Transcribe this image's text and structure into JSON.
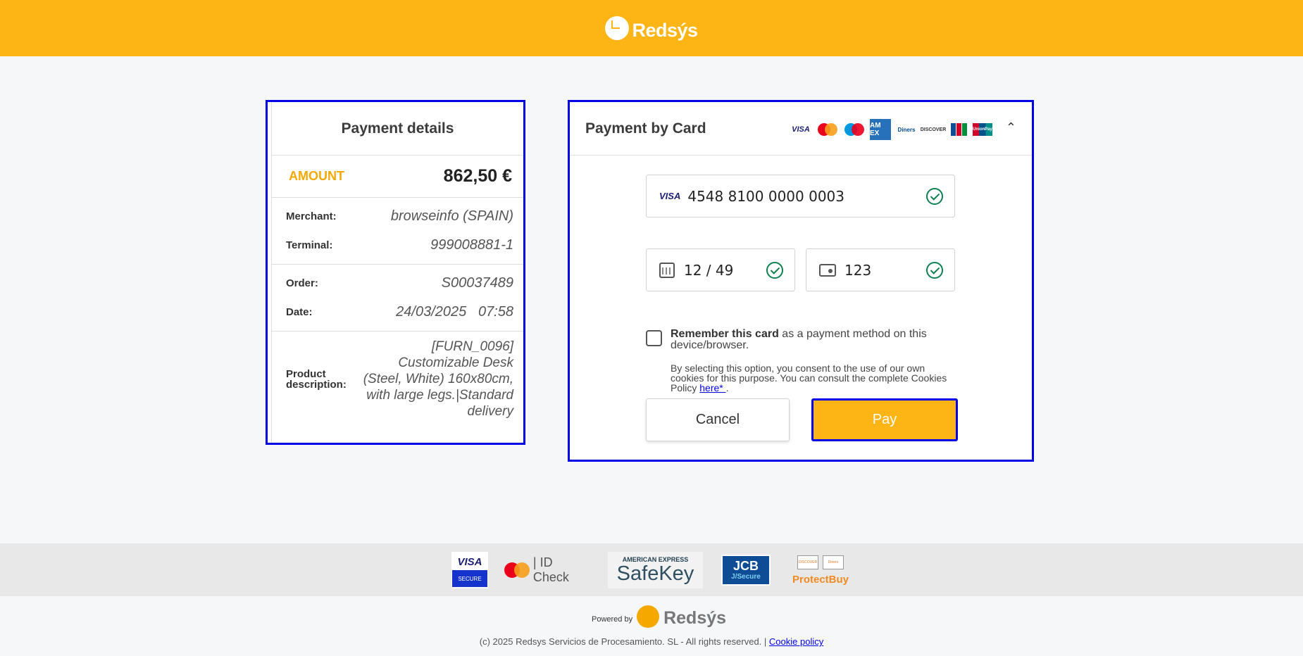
{
  "header": {
    "brand": "Redsýs"
  },
  "details": {
    "title": "Payment details",
    "amount_label": "AMOUNT",
    "amount_value": "862,50 €",
    "merchant_label": "Merchant:",
    "merchant_value": "browseinfo (SPAIN)",
    "terminal_label": "Terminal:",
    "terminal_value": "999008881-1",
    "order_label": "Order:",
    "order_value": "S00037489",
    "date_label": "Date:",
    "date_value": "24/03/2025   07:58",
    "product_label": "Product description:",
    "product_value": "[FURN_0096] Customizable Desk (Steel, White) 160x80cm, with large legs.|Standard delivery"
  },
  "card": {
    "title": "Payment by Card",
    "brand_icons": [
      "visa-icon",
      "mastercard-icon",
      "maestro-icon",
      "amex-icon",
      "diners-icon",
      "discover-icon",
      "jcb-icon",
      "unionpay-icon"
    ],
    "brand_texts": {
      "visa": "VISA",
      "amex": "AM EX",
      "diners": "Diners",
      "discover": "DISCOVER",
      "unionpay": "UnionPay"
    },
    "number_brand": "VISA",
    "card_number": "4548 8100 0000 0003",
    "expiry": "12 / 49",
    "cvv": "123",
    "remember_bold": "Remember this card",
    "remember_rest": "as a payment method on this device/browser.",
    "consent_text": "By selecting this option, you consent to the use of our own cookies for this purpose. You can consult the complete Cookies Policy",
    "consent_link": "here* ",
    "consent_end": ".",
    "cancel_label": "Cancel",
    "pay_label": "Pay"
  },
  "footer": {
    "visa_top": "VISA",
    "visa_bottom": "SECURE",
    "mc_text": "| ID Check",
    "amex_top": "AMERICAN EXPRESS",
    "amex_main": "SafeKey",
    "jcb_top": "JCB",
    "jcb_bottom": "J/Secure",
    "discover_a": "DISCOVER",
    "discover_b": "Diners",
    "protectbuy": "ProtectBuy",
    "powered_by": "Powered by",
    "powered_brand": "Redsýs",
    "copyright": "(c) 2025 Redsys Servicios de Procesamiento. SL - All rights reserved. |",
    "cookie_link": "Cookie policy"
  },
  "colors": {
    "brand_yellow": "#fdb515",
    "focus_blue": "#0000e6",
    "success_green": "#0d8050"
  }
}
